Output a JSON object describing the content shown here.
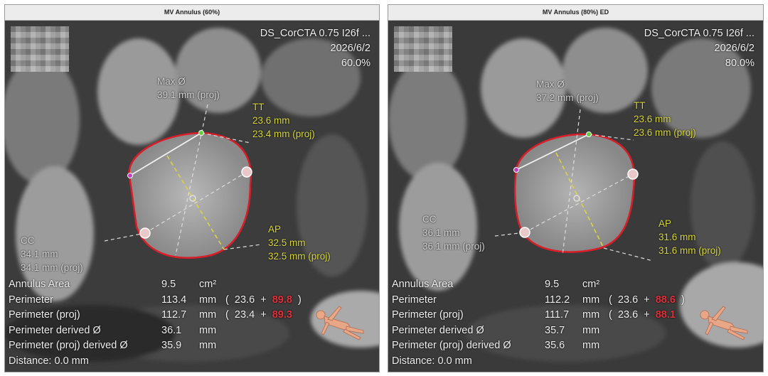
{
  "panels": [
    {
      "title": "MV Annulus  (60%)",
      "info": {
        "series": "DS_CorCTA  0.75  I26f  ...",
        "date": "2026/6/2",
        "phase": "60.0%"
      },
      "max_diameter": {
        "label": "Max Ø",
        "value": "39.1 mm (proj)"
      },
      "tt": {
        "label": "TT",
        "value": "23.6 mm",
        "proj": "23.4 mm (proj)"
      },
      "ap": {
        "label": "AP",
        "value": "32.5 mm",
        "proj": "32.5 mm (proj)"
      },
      "cc": {
        "label": "CC",
        "value": "34.1 mm",
        "proj": "34.1 mm (proj)"
      },
      "stats": {
        "annulus_area": {
          "label": "Annulus Area",
          "value": "9.5",
          "unit": "cm²"
        },
        "perimeter": {
          "label": "Perimeter",
          "value": "113.4",
          "unit": "mm",
          "open": "(",
          "a": "23.6",
          "plus": "+",
          "b": "89.8",
          "close": ")"
        },
        "perimeter_proj": {
          "label": "Perimeter (proj)",
          "value": "112.7",
          "unit": "mm",
          "open": "(",
          "a": "23.4",
          "plus": "+",
          "b": "89.3",
          "close": ")"
        },
        "perimeter_derived": {
          "label": "Perimeter derived Ø",
          "value": "36.1",
          "unit": "mm"
        },
        "perimeter_proj_derived": {
          "label": "Perimeter (proj) derived Ø",
          "value": "35.9",
          "unit": "mm"
        },
        "distance": "Distance: 0.0 mm"
      }
    },
    {
      "title": "MV Annulus  (80%) ED",
      "info": {
        "series": "DS_CorCTA  0.75  I26f  ...",
        "date": "2026/6/2",
        "phase": "80.0%"
      },
      "max_diameter": {
        "label": "Max Ø",
        "value": "37.2 mm (proj)"
      },
      "tt": {
        "label": "TT",
        "value": "23.6 mm",
        "proj": "23.6 mm (proj)"
      },
      "ap": {
        "label": "AP",
        "value": "31.6 mm",
        "proj": "31.6 mm (proj)"
      },
      "cc": {
        "label": "CC",
        "value": "36.1 mm",
        "proj": "36.1 mm (proj)"
      },
      "stats": {
        "annulus_area": {
          "label": "Annulus Area",
          "value": "9.5",
          "unit": "cm²"
        },
        "perimeter": {
          "label": "Perimeter",
          "value": "112.2",
          "unit": "mm",
          "open": "(",
          "a": "23.6",
          "plus": "+",
          "b": "88.6",
          "close": ")"
        },
        "perimeter_proj": {
          "label": "Perimeter (proj)",
          "value": "111.7",
          "unit": "mm",
          "open": "(",
          "a": "23.6",
          "plus": "+",
          "b": "88.1",
          "close": ")"
        },
        "perimeter_derived": {
          "label": "Perimeter derived Ø",
          "value": "35.7",
          "unit": "mm"
        },
        "perimeter_proj_derived": {
          "label": "Perimeter (proj) derived Ø",
          "value": "35.6",
          "unit": "mm"
        },
        "distance": "Distance: 0.0 mm"
      }
    }
  ],
  "colors": {
    "contour": "#d81e28",
    "measure_label": "#d6d640",
    "highlight_value": "#e0303a"
  },
  "icons": [
    "anonymized-patient-blur",
    "patient-orientation-figure-icon"
  ]
}
